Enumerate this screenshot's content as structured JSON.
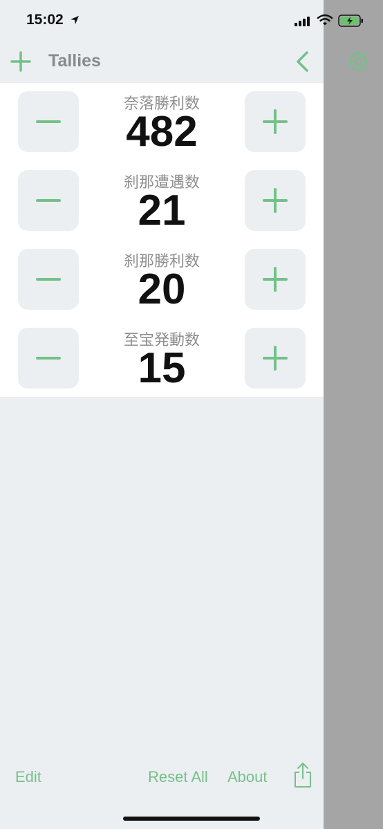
{
  "status_bar": {
    "time": "15:02"
  },
  "nav": {
    "title": "Tallies"
  },
  "tallies": [
    {
      "label": "奈落勝利数",
      "count": "482"
    },
    {
      "label": "刹那遭遇数",
      "count": "21"
    },
    {
      "label": "刹那勝利数",
      "count": "20"
    },
    {
      "label": "至宝発動数",
      "count": "15"
    }
  ],
  "toolbar": {
    "edit_label": "Edit",
    "reset_label": "Reset All",
    "about_label": "About"
  },
  "colors": {
    "accent": "#74c08a",
    "background": "#eceff1",
    "list_background": "#ffffff",
    "side_panel": "#a5a5a5"
  },
  "icons": [
    "location-arrow-icon",
    "signal-icon",
    "wifi-icon",
    "battery-charging-icon",
    "plus-icon",
    "chevron-left-icon",
    "gear-icon",
    "minus-icon",
    "share-icon"
  ]
}
